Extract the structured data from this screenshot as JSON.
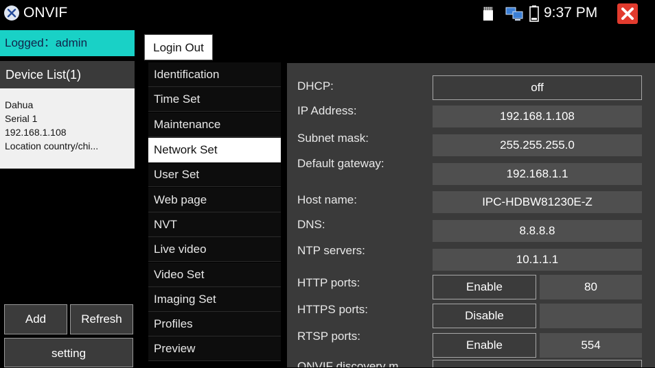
{
  "titlebar": {
    "app_title": "ONVIF",
    "clock": "9:37 PM"
  },
  "sidebar": {
    "logged": "Logged：admin",
    "device_list_title": "Device List(1)",
    "device": {
      "name": "Dahua",
      "serial": "Serial  1",
      "ip": "192.168.1.108",
      "location": "Location  country/chi..."
    },
    "add_label": "Add",
    "refresh_label": "Refresh",
    "setting_label": "setting"
  },
  "toolbar": {
    "loginout_label": "Login Out"
  },
  "menu": {
    "items": [
      {
        "label": "Identification"
      },
      {
        "label": "Time Set"
      },
      {
        "label": "Maintenance"
      },
      {
        "label": "Network Set"
      },
      {
        "label": "User Set"
      },
      {
        "label": "Web page"
      },
      {
        "label": "NVT"
      },
      {
        "label": "Live video"
      },
      {
        "label": "Video Set"
      },
      {
        "label": "Imaging Set"
      },
      {
        "label": "Profiles"
      },
      {
        "label": "Preview"
      }
    ],
    "active": "Network Set"
  },
  "network": {
    "dhcp": {
      "label": "DHCP:",
      "value": "off"
    },
    "ip": {
      "label": "IP Address:",
      "value": "192.168.1.108"
    },
    "subnet": {
      "label": "Subnet mask:",
      "value": "255.255.255.0"
    },
    "gateway": {
      "label": "Default gateway:",
      "value": "192.168.1.1"
    },
    "host": {
      "label": "Host name:",
      "value": "IPC-HDBW81230E-Z"
    },
    "dns": {
      "label": "DNS:",
      "value": "8.8.8.8"
    },
    "ntp": {
      "label": "NTP servers:",
      "value": "10.1.1.1"
    },
    "http": {
      "label": "HTTP ports:",
      "state": "Enable",
      "port": "80"
    },
    "https": {
      "label": "HTTPS ports:",
      "state": "Disable",
      "port": ""
    },
    "rtsp": {
      "label": "RTSP ports:",
      "state": "Enable",
      "port": "554"
    },
    "discovery": {
      "label": "ONVIF discovery m..."
    }
  },
  "colors": {
    "accent": "#19d1c6",
    "close": "#e23b2e",
    "panel": "#3a3a3a"
  },
  "icons": [
    "onvif-app-icon",
    "sd-card-icon",
    "network-icon",
    "battery-icon",
    "close-icon"
  ]
}
